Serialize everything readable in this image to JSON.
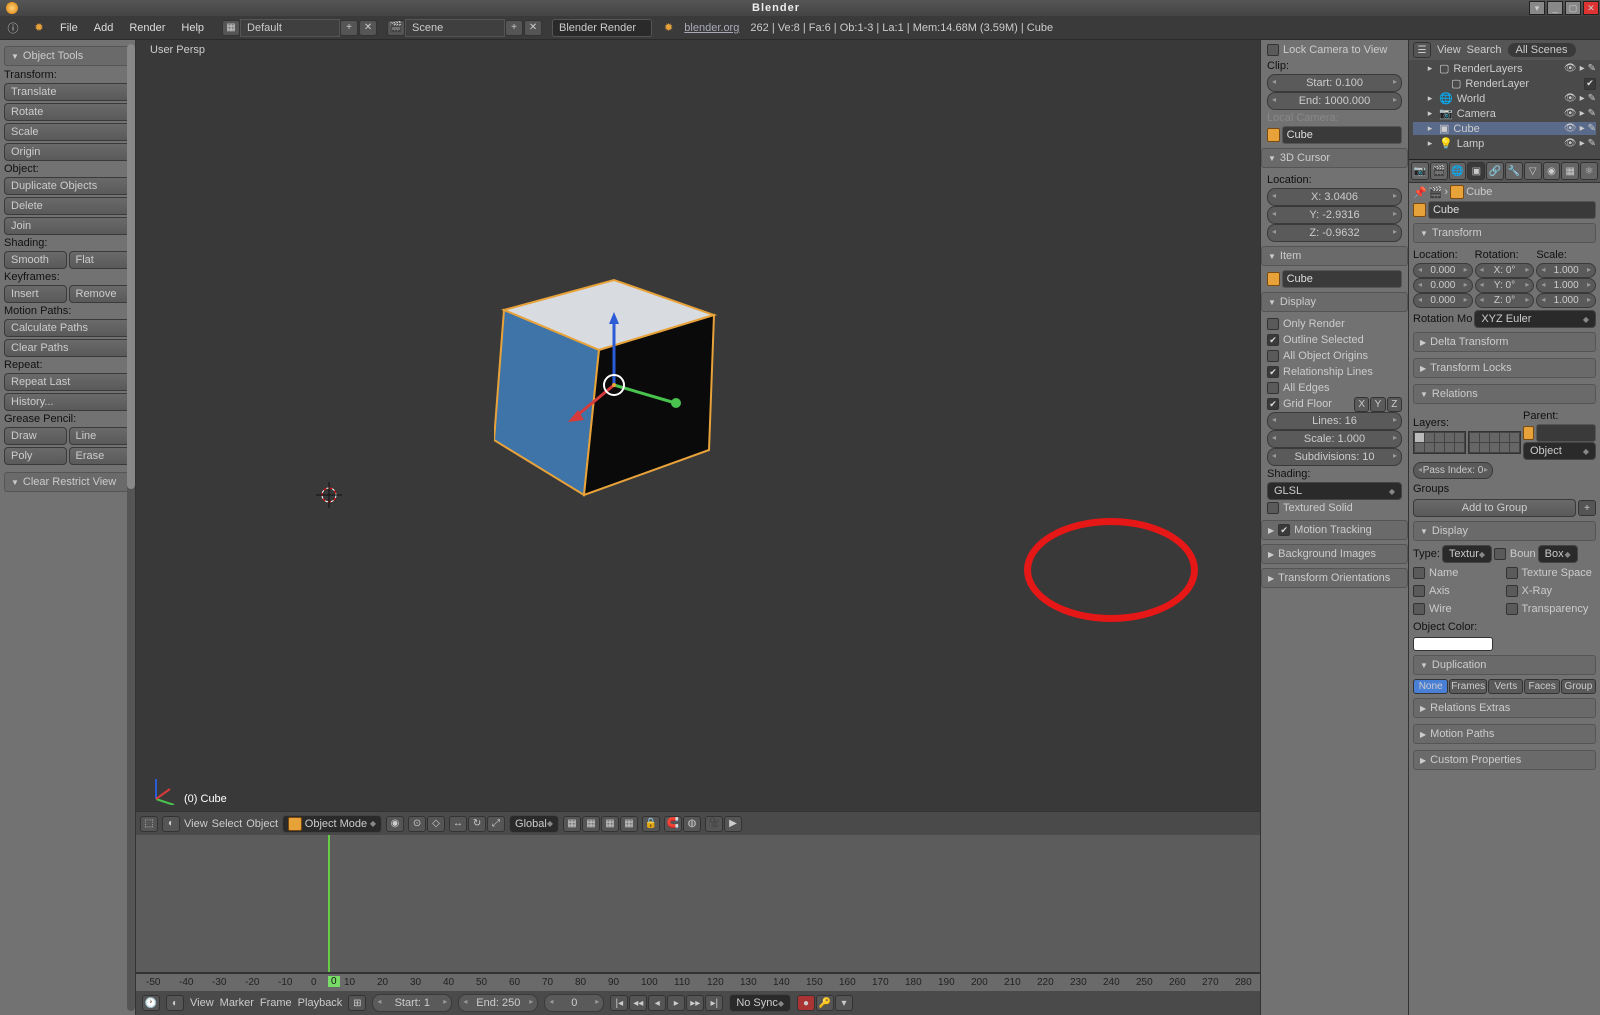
{
  "title": "Blender",
  "menu": {
    "file": "File",
    "add": "Add",
    "render": "Render",
    "help": "Help"
  },
  "layout_preset": "Default",
  "scene": "Scene",
  "engine": "Blender Render",
  "status": {
    "link": "blender.org",
    "version": "262",
    "rest": "| Ve:8 | Fa:6 | Ob:1-3 | La:1 | Mem:14.68M (3.59M) | Cube"
  },
  "toolshelf": {
    "header": "Object Tools",
    "transform": "Transform:",
    "translate": "Translate",
    "rotate": "Rotate",
    "scale": "Scale",
    "origin": "Origin",
    "object": "Object:",
    "duplicate": "Duplicate Objects",
    "delete": "Delete",
    "join": "Join",
    "shading": "Shading:",
    "smooth": "Smooth",
    "flat": "Flat",
    "keyframes": "Keyframes:",
    "insert": "Insert",
    "remove": "Remove",
    "motion": "Motion Paths:",
    "calc": "Calculate Paths",
    "clear": "Clear Paths",
    "repeat": "Repeat:",
    "repeat_last": "Repeat Last",
    "history": "History...",
    "grease": "Grease Pencil:",
    "draw": "Draw",
    "line": "Line",
    "poly": "Poly",
    "erase": "Erase",
    "clear_restrict": "Clear Restrict View"
  },
  "viewport": {
    "persp": "User Persp",
    "object": "(0) Cube",
    "menu": {
      "view": "View",
      "select": "Select",
      "object": "Object"
    },
    "mode": "Object Mode",
    "orientation": "Global"
  },
  "n_panel": {
    "lock_cam": "Lock Camera to View",
    "clip": "Clip:",
    "clip_start": "Start: 0.100",
    "clip_end": "End: 1000.000",
    "local_cam": "Local Camera:",
    "cam_name": "Cube",
    "cursor_hdr": "3D Cursor",
    "location": "Location:",
    "x": "X: 3.0406",
    "y": "Y: -2.9316",
    "z": "Z: -0.9632",
    "item_hdr": "Item",
    "item_name": "Cube",
    "display_hdr": "Display",
    "only_render": "Only Render",
    "outline_sel": "Outline Selected",
    "all_origins": "All Object Origins",
    "rel_lines": "Relationship Lines",
    "all_edges": "All Edges",
    "grid_floor": "Grid Floor",
    "grid_x": "X",
    "grid_y": "Y",
    "grid_z": "Z",
    "lines": "Lines: 16",
    "gscale": "Scale: 1.000",
    "subdiv": "Subdivisions: 10",
    "shading_lbl": "Shading:",
    "shading": "GLSL",
    "tex_solid": "Textured Solid",
    "mtrack": "Motion Tracking",
    "bg_img": "Background Images",
    "torient": "Transform Orientations"
  },
  "outliner": {
    "view": "View",
    "search": "Search",
    "filter": "All Scenes",
    "items": [
      {
        "name": "RenderLayers",
        "indent": 1
      },
      {
        "name": "RenderLayer",
        "indent": 2,
        "check": true
      },
      {
        "name": "World",
        "indent": 1,
        "icon": "🌐"
      },
      {
        "name": "Camera",
        "indent": 1,
        "icon": "📷"
      },
      {
        "name": "Cube",
        "indent": 1,
        "icon": "▣",
        "sel": true
      },
      {
        "name": "Lamp",
        "indent": 1,
        "icon": "💡"
      }
    ]
  },
  "props": {
    "crumb": "Cube",
    "namefield": "Cube",
    "transform": "Transform",
    "loc": "Location:",
    "rot": "Rotation:",
    "scl": "Scale:",
    "locx": "0.000",
    "locy": "0.000",
    "locz": "0.000",
    "rotx": "X: 0°",
    "roty": "Y: 0°",
    "rotz": "Z: 0°",
    "sclx": "1.000",
    "scly": "1.000",
    "sclz": "1.000",
    "rot_mode_lbl": "Rotation Mo",
    "rot_mode": "XYZ Euler",
    "delta": "Delta Transform",
    "tlocks": "Transform Locks",
    "relations": "Relations",
    "layers": "Layers:",
    "parent": "Parent:",
    "parent_type": "Object",
    "pass_index": "Pass Index: 0",
    "groups": "Groups",
    "add_group": "Add to Group",
    "display": "Display",
    "type": "Type:",
    "type_v": "Textur",
    "boun": "Boun",
    "boun_v": "Box",
    "d_name": "Name",
    "d_texspace": "Texture Space",
    "d_axis": "Axis",
    "d_xray": "X-Ray",
    "d_wire": "Wire",
    "d_transp": "Transparency",
    "obj_color": "Object Color:",
    "duplication": "Duplication",
    "dup": {
      "none": "None",
      "frames": "Frames",
      "verts": "Verts",
      "faces": "Faces",
      "group": "Group"
    },
    "rel_ex": "Relations Extras",
    "mpaths": "Motion Paths",
    "cprops": "Custom Properties"
  },
  "timeline": {
    "ticks": [
      -50,
      -40,
      -30,
      -20,
      -10,
      0,
      10,
      20,
      30,
      40,
      50,
      60,
      70,
      80,
      90,
      100,
      110,
      120,
      130,
      140,
      150,
      160,
      170,
      180,
      190,
      200,
      210,
      220,
      230,
      240,
      250,
      260,
      270,
      280
    ],
    "menu": {
      "view": "View",
      "marker": "Marker",
      "frame": "Frame",
      "playback": "Playback"
    },
    "start": "Start: 1",
    "end": "End: 250",
    "current": "0",
    "sync": "No Sync"
  }
}
